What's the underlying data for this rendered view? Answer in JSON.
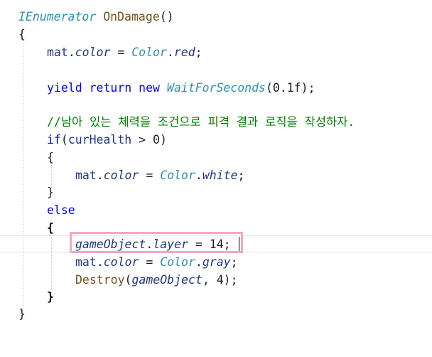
{
  "editor": {
    "lines": {
      "l1": {
        "t1": "IEnumerator",
        "t2": " ",
        "t3": "OnDamage",
        "t4": "()"
      },
      "l2": {
        "t1": "{"
      },
      "l3": {
        "t1": "mat",
        "t2": ".",
        "t3": "color",
        "t4": " = ",
        "t5": "Color",
        "t6": ".",
        "t7": "red",
        "t8": ";"
      },
      "l4": {
        "t1": "yield",
        "t2": " ",
        "t3": "return",
        "t4": " ",
        "t5": "new",
        "t6": " ",
        "t7": "WaitForSeconds",
        "t8": "(0.1f);"
      },
      "l5": {
        "t1": "//남아 있는 체력을 조건으로 피격 결과 로직을 작성하자."
      },
      "l6": {
        "t1": "if",
        "t2": "(",
        "t3": "curHealth",
        "t4": " > 0)"
      },
      "l7": {
        "t1": "{"
      },
      "l8": {
        "t1": "mat",
        "t2": ".",
        "t3": "color",
        "t4": " = ",
        "t5": "Color",
        "t6": ".",
        "t7": "white",
        "t8": ";"
      },
      "l9": {
        "t1": "}"
      },
      "l10": {
        "t1": "else"
      },
      "l11": {
        "t1": "{"
      },
      "l12": {
        "t1": "gameObject",
        "t2": ".",
        "t3": "layer",
        "t4": " = 14;"
      },
      "l13": {
        "t1": "mat",
        "t2": ".",
        "t3": "color",
        "t4": " = ",
        "t5": "Color",
        "t6": ".",
        "t7": "gray",
        "t8": ";"
      },
      "l14": {
        "t1": "Destroy",
        "t2": "(",
        "t3": "gameObject",
        "t4": ", 4);"
      },
      "l15": {
        "t1": "}"
      },
      "l16": {
        "t1": "}"
      }
    },
    "colors": {
      "keyword": "#0000ff",
      "type": "#2b91af",
      "method": "#74531f",
      "property": "#1f377f",
      "comment": "#008000",
      "highlight_border": "#f4a6c6"
    }
  }
}
